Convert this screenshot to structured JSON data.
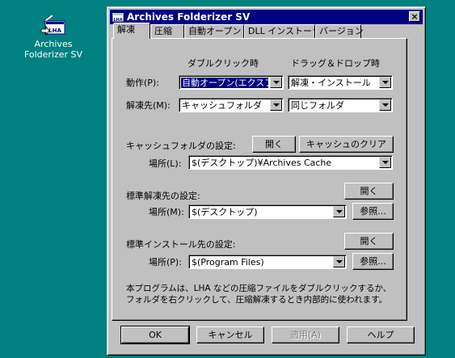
{
  "desktop": {
    "icon_label": "Archives\nFolderizer SV"
  },
  "window": {
    "title": "Archives Folderizer SV",
    "close": "×"
  },
  "tabs": [
    "解凍",
    "圧縮",
    "自動オープン",
    "DLL インストーラ",
    "バージョン"
  ],
  "columns": {
    "double_click": "ダブルクリック時",
    "drag_drop": "ドラッグ＆ドロップ時"
  },
  "action": {
    "label": "動作(P):",
    "double_click_value": "自動オープン(エクスプ",
    "drag_drop_value": "解凍・インストール"
  },
  "extract_to": {
    "label": "解凍先(M):",
    "double_click_value": "キャッシュフォルダ",
    "drag_drop_value": "同じフォルダ"
  },
  "cache": {
    "heading": "キャッシュフォルダの設定:",
    "open_button": "開く",
    "clear_button": "キャッシュのクリア",
    "location_label": "場所(L):",
    "location_value": "$(デスクトップ)¥Archives Cache"
  },
  "default_extract": {
    "heading": "標準解凍先の設定:",
    "open_button": "開く",
    "location_label": "場所(M):",
    "location_value": "$(デスクトップ)",
    "browse_button": "参照..."
  },
  "default_install": {
    "heading": "標準インストール先の設定:",
    "open_button": "開く",
    "location_label": "場所(P):",
    "location_value": "$(Program Files)",
    "browse_button": "参照..."
  },
  "note": {
    "line1": "本プログラムは、LHA などの圧縮ファイルをダブルクリックするか、",
    "line2": "フォルダを右クリックして、圧縮解凍するとき内部的に使われます。"
  },
  "footer": {
    "ok": "OK",
    "cancel": "キャンセル",
    "apply": "適用(A)",
    "help": "ヘルプ"
  }
}
